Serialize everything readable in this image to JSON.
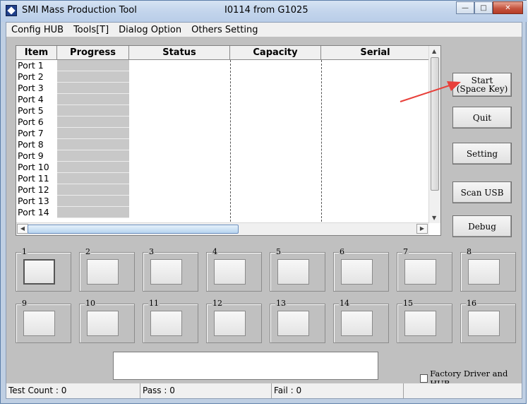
{
  "window": {
    "title": "SMI Mass Production Tool",
    "subtitle": "I0114 from G1025"
  },
  "menu": [
    "Config HUB",
    "Tools[T]",
    "Dialog Option",
    "Others Setting"
  ],
  "grid": {
    "columns": [
      "Item",
      "Progress",
      "Status",
      "Capacity",
      "Serial"
    ],
    "rows": [
      "Port 1",
      "Port 2",
      "Port 3",
      "Port 4",
      "Port 5",
      "Port 6",
      "Port 7",
      "Port 8",
      "Port 9",
      "Port 10",
      "Port 11",
      "Port 12",
      "Port 13",
      "Port 14"
    ]
  },
  "buttons": {
    "start": "Start\n(Space Key)",
    "quit": "Quit",
    "setting": "Setting",
    "scan_usb": "Scan USB",
    "debug": "Debug"
  },
  "slots": [
    "1",
    "2",
    "3",
    "4",
    "5",
    "6",
    "7",
    "8",
    "9",
    "10",
    "11",
    "12",
    "13",
    "14",
    "15",
    "16"
  ],
  "factory_checkbox": {
    "label": "Factory Driver and HUB",
    "checked": false
  },
  "status": {
    "test_count": "Test Count : 0",
    "pass": "Pass : 0",
    "fail": "Fail : 0"
  },
  "colors": {
    "annotation_arrow": "#e8403a"
  }
}
